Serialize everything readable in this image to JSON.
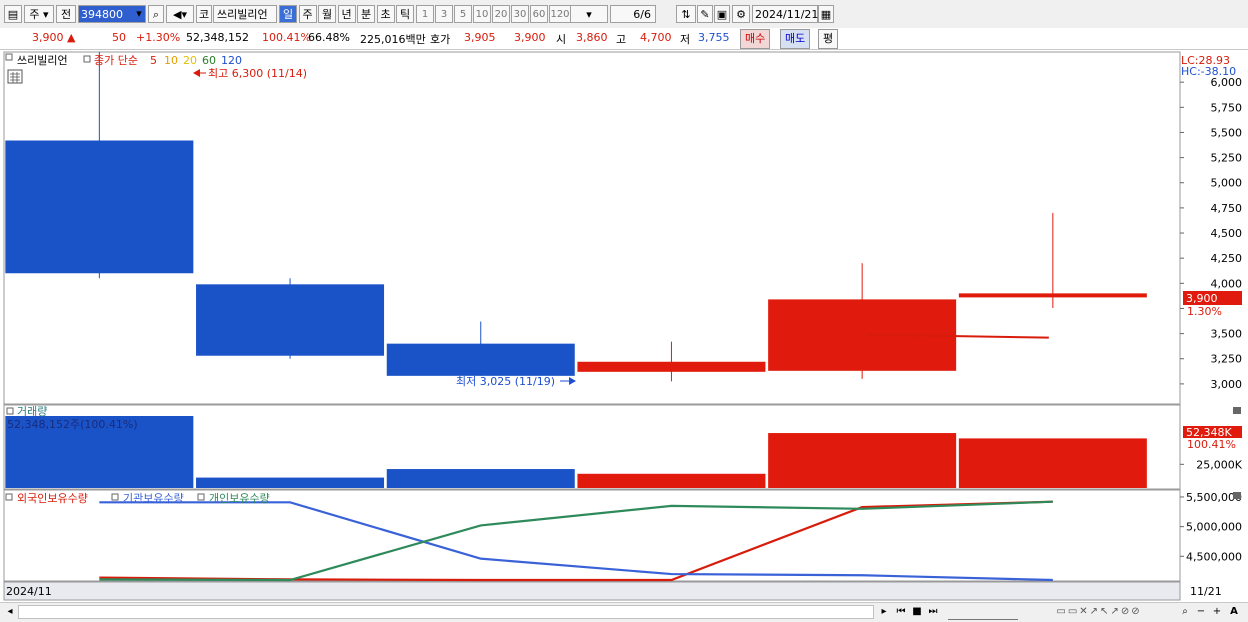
{
  "toolbar": {
    "mode": "주",
    "prev": "전",
    "code": "394800",
    "market": "코",
    "name": "쓰리빌리언",
    "periods": [
      "일",
      "주",
      "월",
      "년",
      "분",
      "초",
      "틱"
    ],
    "active_period": "일",
    "intervals": [
      "1",
      "3",
      "5",
      "10",
      "20",
      "30",
      "60",
      "120"
    ],
    "count": "6/6",
    "date": "2024/11/21"
  },
  "infobar": {
    "price": "3,900",
    "change": "50",
    "change_pct": "+1.30%",
    "volume": "52,348,152",
    "volume_ratio": "100.41%",
    "turnover": "66.48%",
    "amount": "225,016백만",
    "quote_label": "호가",
    "ask": "3,905",
    "bid": "3,900",
    "open_label": "시",
    "open": "3,860",
    "high_label": "고",
    "high": "4,700",
    "low_label": "저",
    "low": "3,755",
    "buy": "매수",
    "sell": "매도",
    "avg": "평"
  },
  "legend": {
    "name": "쓰리빌리언",
    "ma_label": "종가 단순",
    "ma": [
      "5",
      "10",
      "20",
      "60",
      "120"
    ],
    "ma_colors": [
      "#d81c0c",
      "#e0a000",
      "#e0c000",
      "#2a7d2a",
      "#1f4fd0"
    ],
    "lc": "LC:28.93",
    "hc": "HC:-38.10",
    "high_note": "최고 6,300 (11/14)",
    "low_note": "최저 3,025 (11/19)",
    "price_tag": "3,900",
    "price_pct": "1.30%"
  },
  "volume_panel": {
    "title": "거래량",
    "info": "52,348,152주(100.41%)",
    "tag": "52,348K",
    "tag_pct": "100.41%"
  },
  "holdings_panel": {
    "titles": [
      "외국인보유수량",
      "기관보유수량",
      "개인보유수량"
    ]
  },
  "footer": {
    "start": "2024/11",
    "end": "11/21"
  },
  "chart_data": [
    {
      "type": "candlestick",
      "candles": [
        {
          "open": 5420,
          "close": 4100,
          "high": 6300,
          "low": 4050
        },
        {
          "open": 3990,
          "close": 3280,
          "high": 4050,
          "low": 3250
        },
        {
          "open": 3400,
          "close": 3080,
          "high": 3620,
          "low": 3080
        },
        {
          "open": 3120,
          "close": 3220,
          "high": 3420,
          "low": 3025
        },
        {
          "open": 3130,
          "close": 3840,
          "high": 4200,
          "low": 3050
        },
        {
          "open": 3860,
          "close": 3900,
          "high": 4700,
          "low": 3755
        }
      ],
      "ma5": [
        null,
        null,
        null,
        null,
        3490,
        3460
      ],
      "ylim": [
        2800,
        6300
      ],
      "yticks": [
        3000,
        3250,
        3500,
        3750,
        4000,
        4250,
        4500,
        4750,
        5000,
        5250,
        5500,
        5750,
        6000
      ],
      "ytick_labels": [
        "3,000",
        "3,250",
        "3,500",
        "",
        "4,000",
        "4,250",
        "4,500",
        "4,750",
        "5,000",
        "5,250",
        "5,500",
        "5,750",
        "6,000"
      ]
    },
    {
      "type": "bar",
      "title": "거래량",
      "values": [
        76000000,
        11000000,
        20000000,
        15000000,
        58000000,
        52348152
      ],
      "directions": [
        "down",
        "down",
        "down",
        "up",
        "up",
        "up"
      ],
      "ylim": [
        0,
        76000000
      ],
      "yticks": [
        25000000
      ],
      "ytick_labels": [
        "25,000K"
      ]
    },
    {
      "type": "line",
      "series": [
        {
          "name": "외국인보유수량",
          "color": "#d81c0c",
          "values": [
            4140000,
            4110000,
            4100000,
            4100000,
            5330000,
            5420000
          ]
        },
        {
          "name": "기관보유수량",
          "color": "#3a62d8",
          "values": [
            5410000,
            5410000,
            4460000,
            4200000,
            4180000,
            4100000
          ]
        },
        {
          "name": "개인보유수량",
          "color": "#2e8a5a",
          "values": [
            4110000,
            4100000,
            5020000,
            5350000,
            5300000,
            5420000
          ]
        }
      ],
      "ylim": [
        4100000,
        5550000
      ],
      "yticks": [
        4500000,
        5000000,
        5500000
      ],
      "ytick_labels": [
        "4,500,000",
        "5,000,000",
        "5,500,000"
      ]
    }
  ]
}
